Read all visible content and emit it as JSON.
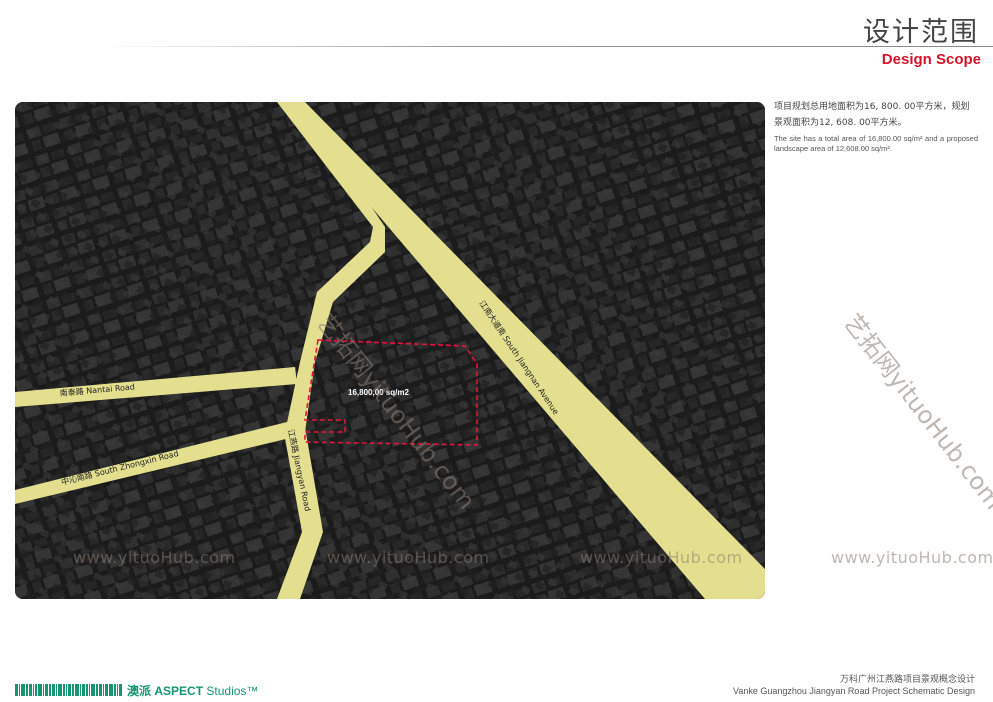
{
  "header": {
    "title_cn": "设计范围",
    "title_en": "Design Scope"
  },
  "description": {
    "cn": "项目规划总用地面积为16, 800. 00平方米，规划景观面积为12, 608. 00平方米。",
    "en": "The site has a total area of 16,800.00 sq/m² and a proposed landscape area of 12,608.00 sq/m²."
  },
  "map": {
    "area_label": "16,800,00 sq/m2",
    "roads": {
      "nantai": "南泰路 Nantai Road",
      "zhongxin": "中沁南路 South Zhongxin Road",
      "jiangyan": "江燕路 Jiangyan Road",
      "jiangnan": "江南大道南 South Jiangnan Avenue"
    },
    "colors": {
      "road": "#e3df8e",
      "site_boundary": "#e0163a",
      "base": "#1e1e1e"
    }
  },
  "watermark": {
    "url": "www.yituoHub.com",
    "diagonal": "艺拓网yituoHub.com"
  },
  "footer": {
    "brand_cn": "澳派",
    "brand_en": "ASPECT",
    "brand_studios": "Studios™",
    "project_cn": "万科广州江燕路项目景观概念设计",
    "project_en": "Vanke Guangzhou Jiangyan Road Project Schematic Design"
  }
}
